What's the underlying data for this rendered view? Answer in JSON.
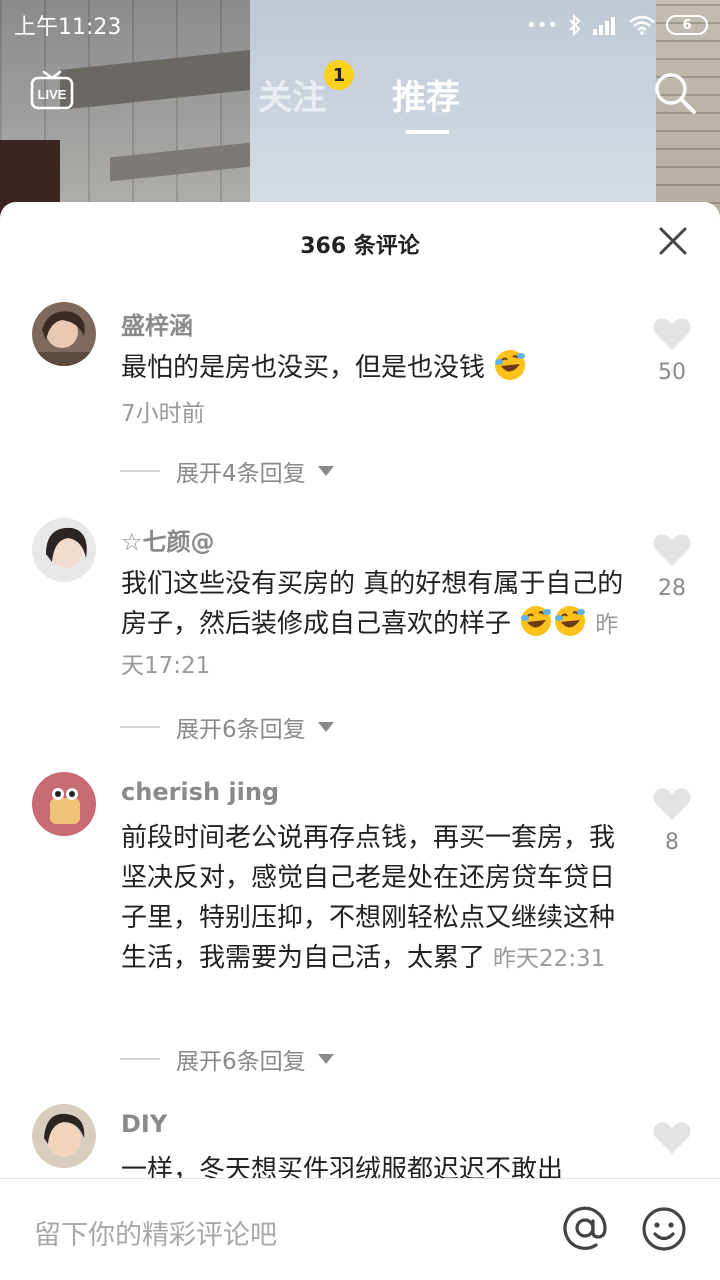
{
  "status_bar": {
    "time": "上午11:23",
    "signal_dots": "•••",
    "battery": "6"
  },
  "nav": {
    "tabs": [
      {
        "label": "关注",
        "badge": "1",
        "active": false
      },
      {
        "label": "推荐",
        "active": true
      }
    ],
    "icons": [
      "live-icon",
      "search-icon"
    ]
  },
  "comments_panel": {
    "title": "366 条评论",
    "comments": [
      {
        "username": "盛梓涵",
        "text": "最怕的是房也没买，但是也没钱",
        "emoji_count": 1,
        "time": "7小时前",
        "likes": "50",
        "replies_label": "展开4条回复"
      },
      {
        "username": "☆七颜@",
        "text": "我们这些没有买房的 真的好想有属于自己的房子，然后装修成自己喜欢的样子",
        "emoji_count": 2,
        "time": "昨天17:21",
        "likes": "28",
        "replies_label": "展开6条回复"
      },
      {
        "username": "cherish jing",
        "text": "前段时间老公说再存点钱，再买一套房，我坚决反对，感觉自己老是处在还房贷车贷日子里，特别压抑，不想刚轻松点又继续这种生活，我需要为自己活，太累了",
        "time": "昨天22:31",
        "likes": "8",
        "replies_label": "展开6条回复"
      },
      {
        "username": "DIY",
        "text": "一样，冬天想买件羽绒服都迟迟不敢出"
      }
    ]
  },
  "input": {
    "placeholder": "留下你的精彩评论吧",
    "icons": [
      "at-icon",
      "smile-icon"
    ]
  },
  "colors": {
    "badge": "#fad21c",
    "muted_text": "#8a8a8a",
    "body_text": "#222222"
  }
}
